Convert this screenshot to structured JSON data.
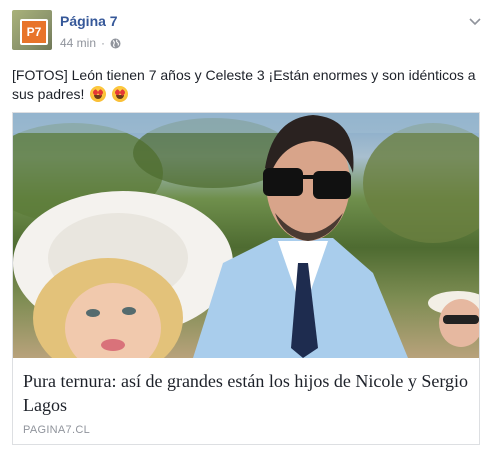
{
  "post": {
    "avatar_text": "P7",
    "page_name": "Página 7",
    "time": "44 min",
    "separator": "·",
    "message": "[FOTOS] León tienen 7 años y Celeste 3 ¡Están enormes y son idénticos a sus padres!",
    "message_emojis": [
      "heart-eyes-emoji",
      "heart-eyes-emoji"
    ]
  },
  "attachment": {
    "headline": "Pura ternura: así de grandes están los hijos de Nicole y Sergio Lagos",
    "source": "PAGINA7.CL"
  },
  "colors": {
    "link_blue": "#365899",
    "meta_gray": "#90949c",
    "text": "#1d2129",
    "border": "#dddfe2"
  }
}
